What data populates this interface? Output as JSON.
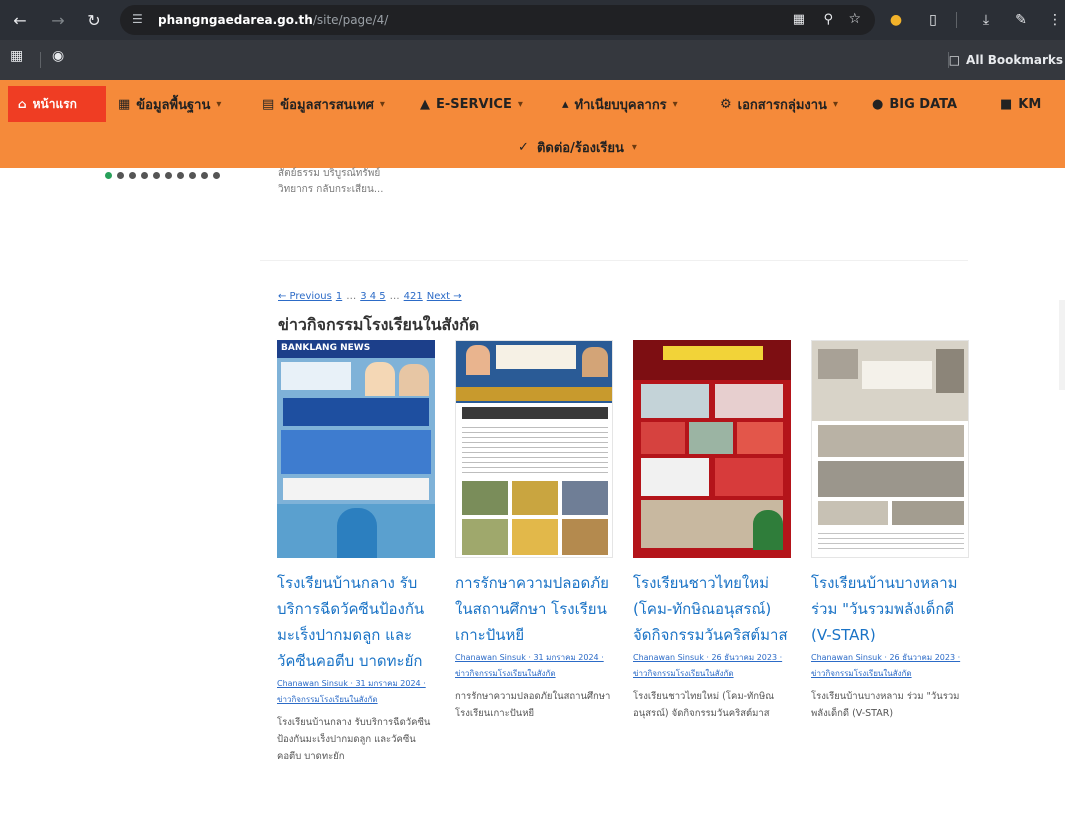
{
  "browser": {
    "url_host": "phangngaedarea.go.th",
    "url_path": "/site/page/4/",
    "bookmarks_label": "All Bookmarks"
  },
  "nav": {
    "home": "หน้าแรก",
    "items": [
      {
        "label": "ข้อมูลพื้นฐาน",
        "icon": "table-icon"
      },
      {
        "label": "ข้อมูลสารสนเทศ",
        "icon": "document-icon"
      },
      {
        "label": "E-SERVICE",
        "icon": "people-icon"
      },
      {
        "label": "ทำเนียบบุคลากร",
        "icon": "org-icon"
      },
      {
        "label": "เอกสารกลุ่มงาน",
        "icon": "gear-icon"
      },
      {
        "label": "BIG DATA",
        "icon": "circle-icon"
      },
      {
        "label": "KM",
        "icon": "book-icon"
      }
    ],
    "row2_item": "ติดต่อ/ร้องเรียน"
  },
  "snippet": {
    "line1": "สัตย์ธรรม บริบูรณ์ทรัพย์",
    "line2": "วิทยากร กลับกระเสียน..."
  },
  "pager": {
    "previous": "← Previous",
    "p1": "1",
    "ellipsis1": "…",
    "p345": "3 4 5",
    "ellipsis2": "…",
    "last": "421",
    "next": "Next →"
  },
  "section_title": "ข่าวกิจกรรมโรงเรียนในสังกัด",
  "cards": [
    {
      "title": "โรงเรียนบ้านกลาง รับบริการฉีดวัคซีนป้องกันมะเร็งปากมดลูก และวัคซีนคอตีบ บาดทะยัก",
      "meta1": "Chanawan Sinsuk · 31 มกราคม 2024 ·",
      "meta2": "ข่าวกิจกรรมโรงเรียนในสังกัด",
      "excerpt": "โรงเรียนบ้านกลาง รับบริการฉีดวัคซีนป้องกันมะเร็งปากมดลูก และวัคซีนคอตีบ บาดทะยัก",
      "thumb_banner": "BANKLANG NEWS"
    },
    {
      "title": "การรักษาความปลอดภัยในสถานศึกษา โรงเรียนเกาะปันหยี",
      "meta1": "Chanawan Sinsuk · 31 มกราคม 2024 ·",
      "meta2": "ข่าวกิจกรรมโรงเรียนในสังกัด",
      "excerpt": "การรักษาความปลอดภัยในสถานศึกษา โรงเรียนเกาะปันหยี",
      "thumb_banner": ""
    },
    {
      "title": "โรงเรียนชาวไทยใหม่ (โคม-ทักษิณอนุสรณ์) จัดกิจกรรมวันคริสต์มาส",
      "meta1": "Chanawan Sinsuk · 26 ธันวาคม 2023 ·",
      "meta2": "ข่าวกิจกรรมโรงเรียนในสังกัด",
      "excerpt": "โรงเรียนชาวไทยใหม่ (โคม-ทักษิณอนุสรณ์) จัดกิจกรรมวันคริสต์มาส",
      "thumb_banner": ""
    },
    {
      "title": "โรงเรียนบ้านบางหลาม ร่วม \"วันรวมพลังเด็กดี (V-STAR)",
      "meta1": "Chanawan Sinsuk · 26 ธันวาคม 2023 ·",
      "meta2": "ข่าวกิจกรรมโรงเรียนในสังกัด",
      "excerpt": "โรงเรียนบ้านบางหลาม ร่วม \"วันรวมพลังเด็กดี (V-STAR)",
      "thumb_banner": ""
    }
  ],
  "colors": {
    "nav_bg": "#f58a3a",
    "home_bg": "#ef3d23",
    "link": "#1a73c6",
    "active_dot": "#27a05a"
  }
}
